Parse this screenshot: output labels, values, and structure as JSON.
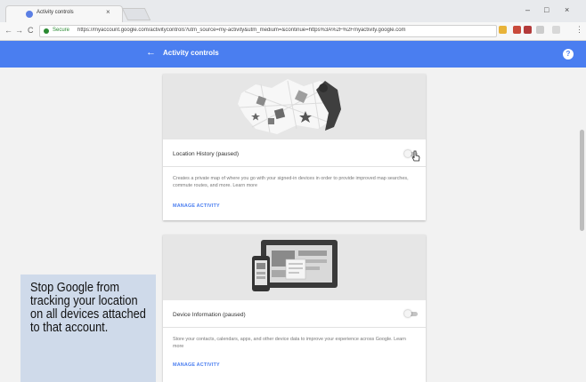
{
  "browser": {
    "tab_title": "Activity controls",
    "tab_close": "×",
    "window_controls": {
      "minimize": "–",
      "maximize": "□",
      "close": "×"
    },
    "nav": {
      "back": "←",
      "forward": "→",
      "reload": "C"
    },
    "security_label": "Secure",
    "url": "https://myaccount.google.com/activitycontrols?utm_source=my-activity&utm_medium=&continue=https%3A%2F%2Fmyactivity.google.com",
    "menu_icon": "⋮"
  },
  "appbar": {
    "title": "Activity controls",
    "back_icon": "←",
    "help_icon": "?",
    "color": "#4a7ef0"
  },
  "cards": [
    {
      "title": "Location History (paused)",
      "toggle_state": "off",
      "description": "Creates a private map of where you go with your signed-in devices in order to provide improved map searches, commute routes, and more. Learn more",
      "link": "MANAGE ACTIVITY"
    },
    {
      "title": "Device Information (paused)",
      "toggle_state": "off",
      "description": "Store your contacts, calendars, apps, and other device data to improve your experience across Google. Learn more",
      "link": "MANAGE ACTIVITY"
    }
  ],
  "caption": {
    "text": "Stop Google from tracking your location on all devices attached to that account."
  }
}
